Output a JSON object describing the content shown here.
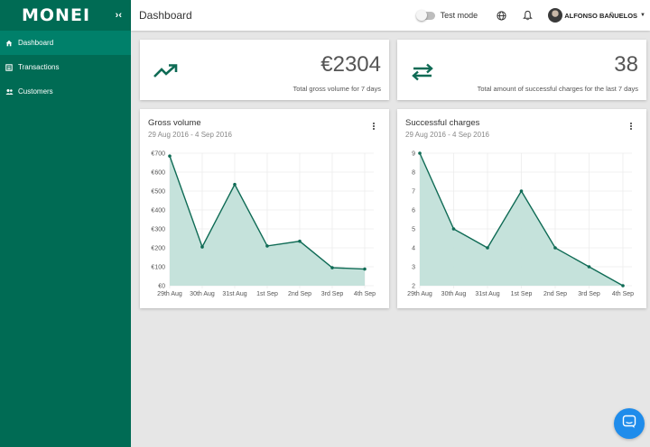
{
  "app": {
    "logo": "MONEI",
    "collapse_label": "›‹"
  },
  "sidebar": {
    "items": [
      {
        "label": "Dashboard",
        "icon": "home-icon",
        "active": true
      },
      {
        "label": "Transactions",
        "icon": "list-icon",
        "active": false
      },
      {
        "label": "Customers",
        "icon": "people-icon",
        "active": false
      }
    ]
  },
  "header": {
    "title": "Dashboard",
    "test_mode_label": "Test mode",
    "test_mode_on": false,
    "user_name": "ALFONSO BAÑUELOS"
  },
  "stats": [
    {
      "value": "€2304",
      "label": "Total gross volume for 7 days",
      "icon": "trending-up-icon"
    },
    {
      "value": "38",
      "label": "Total amount of successful charges for the last 7 days",
      "icon": "swap-arrows-icon"
    }
  ],
  "charts": [
    {
      "title": "Gross volume",
      "subtitle": "29 Aug 2016 - 4 Sep 2016"
    },
    {
      "title": "Successful charges",
      "subtitle": "29 Aug 2016 - 4 Sep 2016"
    }
  ],
  "colors": {
    "brand": "#006b54",
    "brand_active": "#00806a",
    "line": "#0f6b55",
    "area": "#c2e0d9",
    "chat": "#1f8ceb"
  },
  "chart_data": [
    {
      "type": "area",
      "title": "Gross volume",
      "categories": [
        "29th Aug",
        "30th Aug",
        "31st Aug",
        "1st Sep",
        "2nd Sep",
        "3rd Sep",
        "4th Sep"
      ],
      "values": [
        685,
        205,
        535,
        210,
        235,
        95,
        88
      ],
      "ylim": [
        0,
        700
      ],
      "yticks": [
        0,
        100,
        200,
        300,
        400,
        500,
        600,
        700
      ],
      "ytick_labels": [
        "€0",
        "€100",
        "€200",
        "€300",
        "€400",
        "€500",
        "€600",
        "€700"
      ],
      "grid": true
    },
    {
      "type": "area",
      "title": "Successful charges",
      "categories": [
        "29th Aug",
        "30th Aug",
        "31st Aug",
        "1st Sep",
        "2nd Sep",
        "3rd Sep",
        "4th Sep"
      ],
      "values": [
        9,
        5,
        4,
        7,
        4,
        3,
        2
      ],
      "ylim": [
        2,
        9
      ],
      "yticks": [
        2,
        3,
        4,
        5,
        6,
        7,
        8,
        9
      ],
      "ytick_labels": [
        "2",
        "3",
        "4",
        "5",
        "6",
        "7",
        "8",
        "9"
      ],
      "grid": true
    }
  ]
}
